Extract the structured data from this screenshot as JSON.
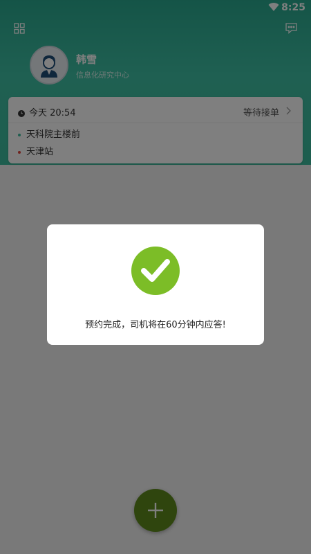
{
  "status_bar": {
    "time": "8:25"
  },
  "profile": {
    "name": "韩雪",
    "department": "信息化研究中心"
  },
  "order": {
    "time": "今天 20:54",
    "status": "等待接单",
    "from": "天科院主楼前",
    "to": "天津站",
    "from_dot_color": "#3dbd9e",
    "to_dot_color": "#e0443a"
  },
  "dialog": {
    "message": "预约完成，司机将在60分钟内应答!"
  },
  "colors": {
    "header": "#3dbd9e",
    "check": "#7cbd27",
    "fab": "#5f8b1c"
  },
  "icons": {
    "grid": "grid-icon",
    "message": "message-icon",
    "clock": "clock-icon",
    "chevron": "chevron-right-icon",
    "check": "checkmark-icon",
    "plus": "plus-icon",
    "wifi": "wifi-icon"
  }
}
